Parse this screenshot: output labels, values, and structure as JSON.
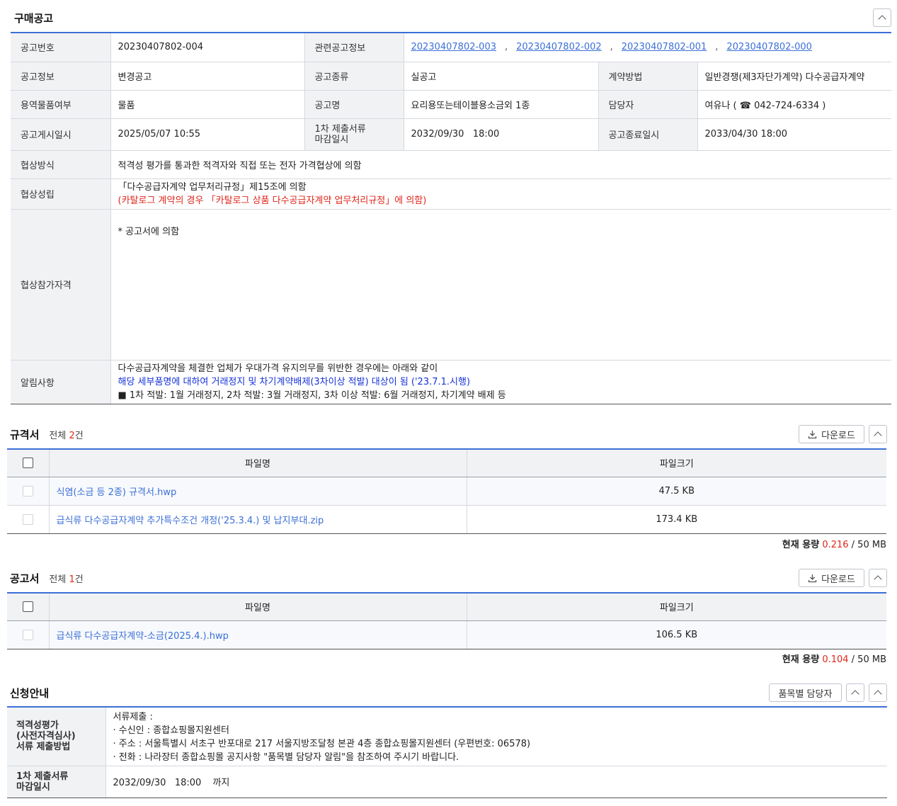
{
  "purchase": {
    "title": "구매공고",
    "rows": {
      "notice_no_label": "공고번호",
      "notice_no": "20230407802-004",
      "related_label": "관련공고정보",
      "related_links": [
        "20230407802-003",
        "20230407802-002",
        "20230407802-001",
        "20230407802-000"
      ],
      "related_sep": ",",
      "info_label": "공고정보",
      "info_value": "변경공고",
      "kind_label": "공고종류",
      "kind_value": "실공고",
      "contract_label": "계약방법",
      "contract_value": "일반경쟁(제3자단가계약) 다수공급자계약",
      "service_label": "용역물품여부",
      "service_value": "물품",
      "name_label": "공고명",
      "name_value": "요리용또는테이블용소금외 1종",
      "manager_label": "담당자",
      "manager_name": "여유나 (",
      "manager_phone_icon": "☎",
      "manager_phone": "042-724-6334 )",
      "posted_label": "공고게시일시",
      "posted_value": "2025/05/07 10:55",
      "deadline_label_1": "1차 제출서류",
      "deadline_label_2": "마감일시",
      "deadline_value": "2032/09/30   18:00",
      "end_label": "공고종료일시",
      "end_value": "2033/04/30 18:00",
      "nego_method_label": "협상방식",
      "nego_method_value": "적격성 평가를 통과한 적격자와 직접 또는 전자 가격협상에 의함",
      "nego_deal_label": "협상성립",
      "nego_deal_line1": "「다수공급자계약 업무처리규정」제15조에 의함",
      "nego_deal_line2": "(카탈로그 계약의 경우 「카탈로그 상품 다수공급자계약 업무처리규정」에 의함)",
      "qual_label": "협상참가자격",
      "qual_value": "* 공고서에 의함",
      "notice_label": "알림사항",
      "notice_line1": "다수공급자계약을 체결한 업체가 우대가격 유지의무를 위반한 경우에는 아래와 같이",
      "notice_line2": "해당 세부품명에 대하여 거래정지 및 차기계약배제(3차이상 적발) 대상이 됨 ('23.7.1.시행)",
      "notice_line3": "■ 1차 적발: 1월 거래정지, 2차 적발: 3월 거래정지, 3차 이상 적발: 6월 거래정지, 차기계약 배제 등"
    }
  },
  "spec": {
    "title": "규격서",
    "count_prefix": "전체",
    "count": "2",
    "count_suffix": "건",
    "download_label": "다운로드",
    "col_name": "파일명",
    "col_size": "파일크기",
    "files": [
      {
        "name": "식염(소금 등 2종) 규격서.hwp",
        "size": "47.5 KB"
      },
      {
        "name": "급식류 다수공급자계약 추가특수조건 개정('25.3.4.) 및 납지부대.zip",
        "size": "173.4 KB"
      }
    ],
    "usage_label": "현재 용량",
    "usage_value": "0.216",
    "usage_total": "/ 50 MB"
  },
  "notice": {
    "title": "공고서",
    "count_prefix": "전체",
    "count": "1",
    "count_suffix": "건",
    "download_label": "다운로드",
    "col_name": "파일명",
    "col_size": "파일크기",
    "files": [
      {
        "name": "급식류 다수공급자계약-소금(2025.4.).hwp",
        "size": "106.5 KB"
      }
    ],
    "usage_label": "현재 용량",
    "usage_value": "0.104",
    "usage_total": "/ 50 MB"
  },
  "apply": {
    "title": "신청안내",
    "manager_btn": "품목별 담당자",
    "method_label_1": "적격성평가",
    "method_label_2": "(사전자격심사)",
    "method_label_3": "서류 제출방법",
    "method_line1": "서류제출 :",
    "method_line2": "· 수신인 : 종합쇼핑몰지원센터",
    "method_line3": "· 주소 : 서울특별시 서초구 반포대로 217 서울지방조달청 본관 4층 종합쇼핑몰지원센터 (우편번호: 06578)",
    "method_line4": "· 전화 : 나라장터 종합쇼핑몰 공지사항 \"품목별 담당자 알림\"을 참조하여 주시기 바랍니다.",
    "deadline_label_1": "1차 제출서류",
    "deadline_label_2": "마감일시",
    "deadline_value": "2032/09/30   18:00",
    "deadline_suffix": "까지"
  },
  "icons": {
    "collapse": "chevron-up-icon",
    "download": "download-icon",
    "phone": "phone-icon"
  },
  "colors": {
    "accent": "#3b6fd8",
    "red": "#e0261b",
    "blue": "#1532d8",
    "header_bg": "#f1f2f4"
  }
}
